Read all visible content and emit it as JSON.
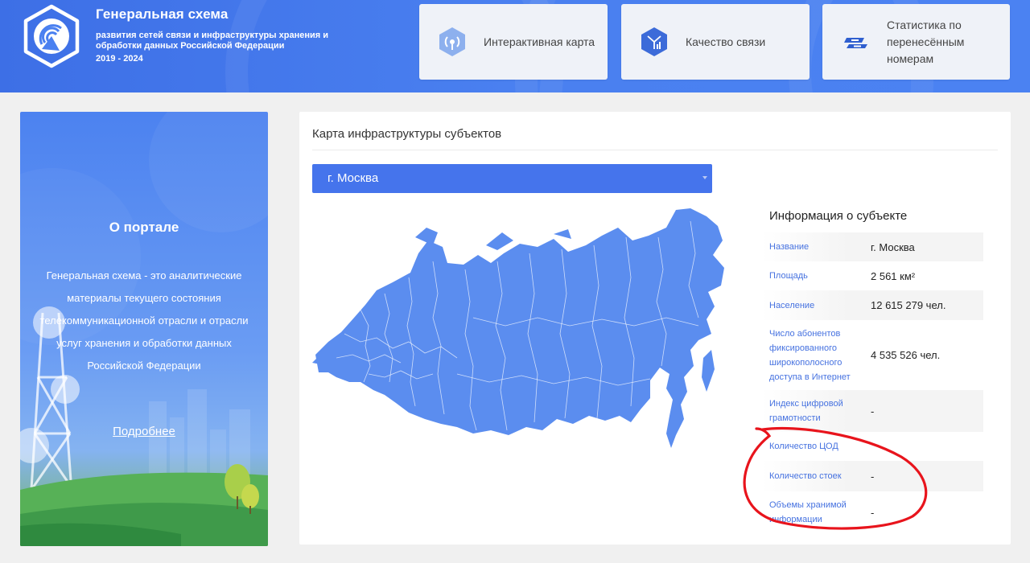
{
  "header": {
    "title": "Генеральная схема",
    "subtitle": "развития сетей связи и инфраструктуры хранения и обработки данных Российской Федерации",
    "years": "2019 - 2024",
    "nav": [
      {
        "label": "Интерактивная карта",
        "icon": "antenna-icon"
      },
      {
        "label": "Качество связи",
        "icon": "signal-icon"
      },
      {
        "label": "Статистика по перенесённым номерам",
        "icon": "sim-transfer-icon"
      }
    ],
    "colors": {
      "background": "#4a80f0",
      "card": "#eff2f8"
    }
  },
  "sidebar": {
    "title": "О портале",
    "text": "Генеральная схема - это аналитические материалы текущего состояния телекоммуникационной отрасли и отрасли услуг хранения и обработки данных Российской Федерации",
    "link": "Подробнее"
  },
  "main": {
    "title": "Карта инфраструктуры субъектов",
    "region": {
      "selected": "г. Москва"
    },
    "info": {
      "title": "Информация о субъекте",
      "rows": [
        {
          "label": "Название",
          "value": "г. Москва"
        },
        {
          "label": "Площадь",
          "value": "2 561 км²"
        },
        {
          "label": "Население",
          "value": "12 615 279 чел."
        },
        {
          "label": "Число абонентов фиксированного широкополосного доступа в Интернет",
          "value": "4 535 526 чел."
        },
        {
          "label": "Индекс цифровой грамотности",
          "value": "-"
        },
        {
          "label": "Количество ЦОД",
          "value": ""
        },
        {
          "label": "Количество стоек",
          "value": "-"
        },
        {
          "label": "Объемы хранимой информации",
          "value": "-"
        }
      ]
    },
    "colors": {
      "map_fill": "#5b8def",
      "select": "#4574ec",
      "label": "#4672e0",
      "annotation": "#e8141c"
    }
  }
}
